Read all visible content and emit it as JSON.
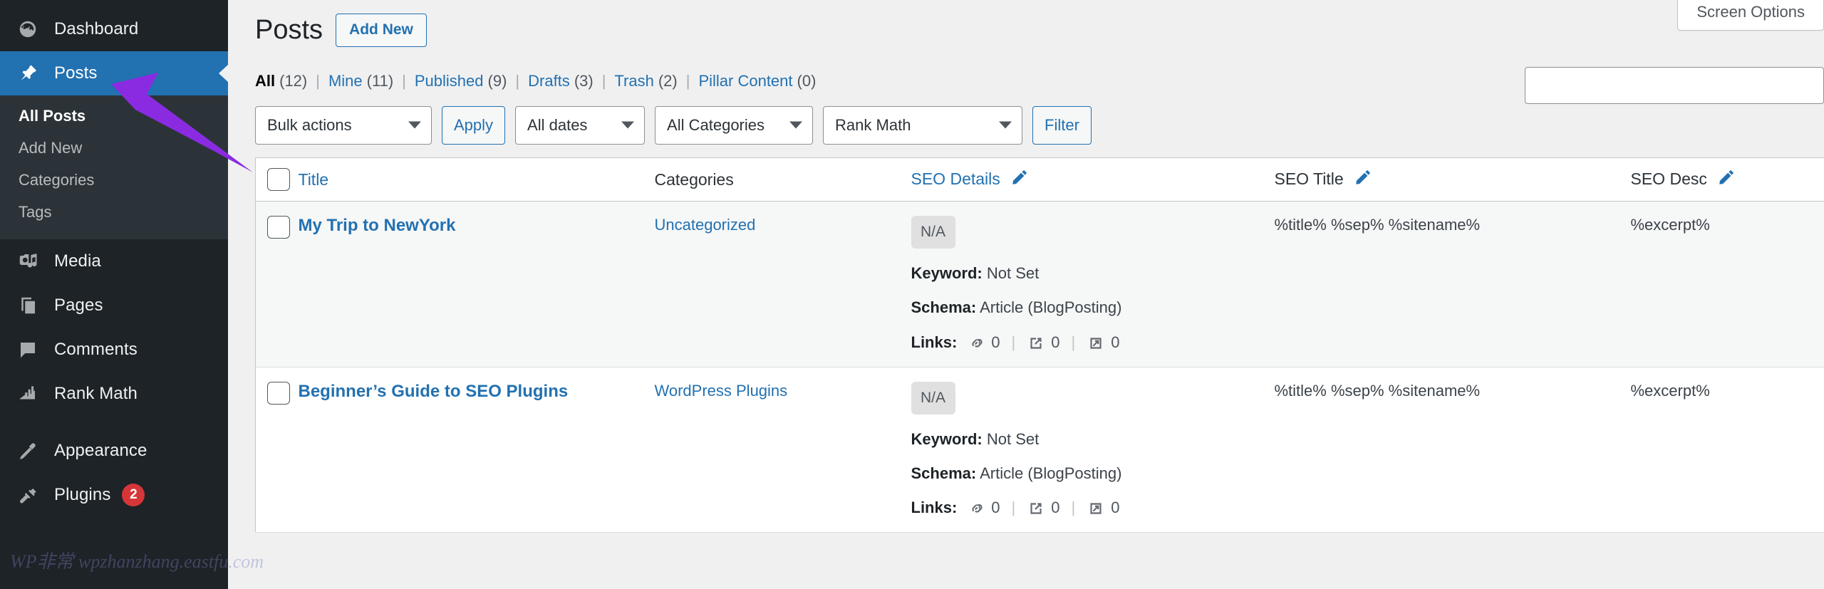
{
  "sidebar": {
    "items": [
      {
        "label": "Dashboard",
        "icon": "dashboard-icon",
        "current": false
      },
      {
        "label": "Posts",
        "icon": "pin-icon",
        "current": true
      },
      {
        "label": "Media",
        "icon": "media-icon",
        "current": false
      },
      {
        "label": "Pages",
        "icon": "pages-icon",
        "current": false
      },
      {
        "label": "Comments",
        "icon": "comment-icon",
        "current": false
      },
      {
        "label": "Rank Math",
        "icon": "rank-math-icon",
        "current": false
      },
      {
        "label": "Appearance",
        "icon": "brush-icon",
        "current": false
      },
      {
        "label": "Plugins",
        "icon": "plug-icon",
        "current": false,
        "badge": "2"
      }
    ],
    "submenu": [
      {
        "label": "All Posts",
        "current": true
      },
      {
        "label": "Add New",
        "current": false
      },
      {
        "label": "Categories",
        "current": false
      },
      {
        "label": "Tags",
        "current": false
      }
    ]
  },
  "header": {
    "screen_options_label": "Screen Options",
    "page_title": "Posts",
    "add_new_label": "Add New"
  },
  "status_links": [
    {
      "label": "All",
      "count": "(12)",
      "current": true
    },
    {
      "label": "Mine",
      "count": "(11)",
      "current": false
    },
    {
      "label": "Published",
      "count": "(9)",
      "current": false
    },
    {
      "label": "Drafts",
      "count": "(3)",
      "current": false
    },
    {
      "label": "Trash",
      "count": "(2)",
      "current": false
    },
    {
      "label": "Pillar Content",
      "count": "(0)",
      "current": false
    }
  ],
  "search": {
    "value": "",
    "placeholder": ""
  },
  "toolbar": {
    "bulk_actions": "Bulk actions",
    "apply_label": "Apply",
    "all_dates": "All dates",
    "all_categories": "All Categories",
    "rank_math": "Rank Math",
    "filter_label": "Filter"
  },
  "table": {
    "headers": {
      "title": "Title",
      "categories": "Categories",
      "seo_details": "SEO Details",
      "seo_title": "SEO Title",
      "seo_desc": "SEO Desc"
    },
    "rows": [
      {
        "title": "My Trip to NewYork",
        "category": "Uncategorized",
        "score": "N/A",
        "keyword_label": "Keyword:",
        "keyword_value": "Not Set",
        "schema_label": "Schema:",
        "schema_value": "Article (BlogPosting)",
        "links_label": "Links:",
        "links_internal": "0",
        "links_external": "0",
        "links_incoming": "0",
        "seo_title": "%title% %sep% %sitename%",
        "seo_desc": "%excerpt%"
      },
      {
        "title": "Beginner’s Guide to SEO Plugins",
        "category": "WordPress Plugins",
        "score": "N/A",
        "keyword_label": "Keyword:",
        "keyword_value": "Not Set",
        "schema_label": "Schema:",
        "schema_value": "Article (BlogPosting)",
        "links_label": "Links:",
        "links_internal": "0",
        "links_external": "0",
        "links_incoming": "0",
        "seo_title": "%title% %sep% %sitename%",
        "seo_desc": "%excerpt%"
      }
    ]
  },
  "watermark": {
    "text": "WP非常 wpzhanzhang.eastfu.com"
  },
  "colors": {
    "sidebar_bg": "#1d2327",
    "submenu_bg": "#2c3338",
    "accent_blue": "#2271b1",
    "badge_red": "#d63638",
    "pointer_purple": "#8a2be2"
  }
}
